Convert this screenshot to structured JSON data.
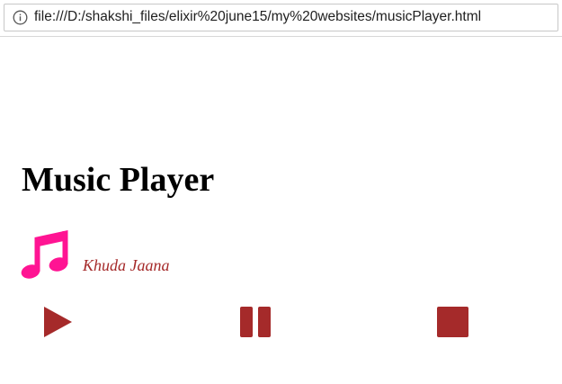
{
  "browser": {
    "url": "file:///D:/shakshi_files/elixir%20june15/my%20websites/musicPlayer.html",
    "info_icon": "info-circle-icon"
  },
  "page": {
    "title": "Music Player"
  },
  "player": {
    "song_title": "Khuda Jaana",
    "song_icon": "music-note-icon",
    "controls": [
      {
        "name": "play",
        "icon": "play-icon"
      },
      {
        "name": "pause",
        "icon": "pause-icon"
      },
      {
        "name": "stop",
        "icon": "stop-icon"
      }
    ]
  },
  "colors": {
    "note": "#ff1493",
    "controls": "#a52a2a",
    "song_title": "#a52a2a"
  }
}
